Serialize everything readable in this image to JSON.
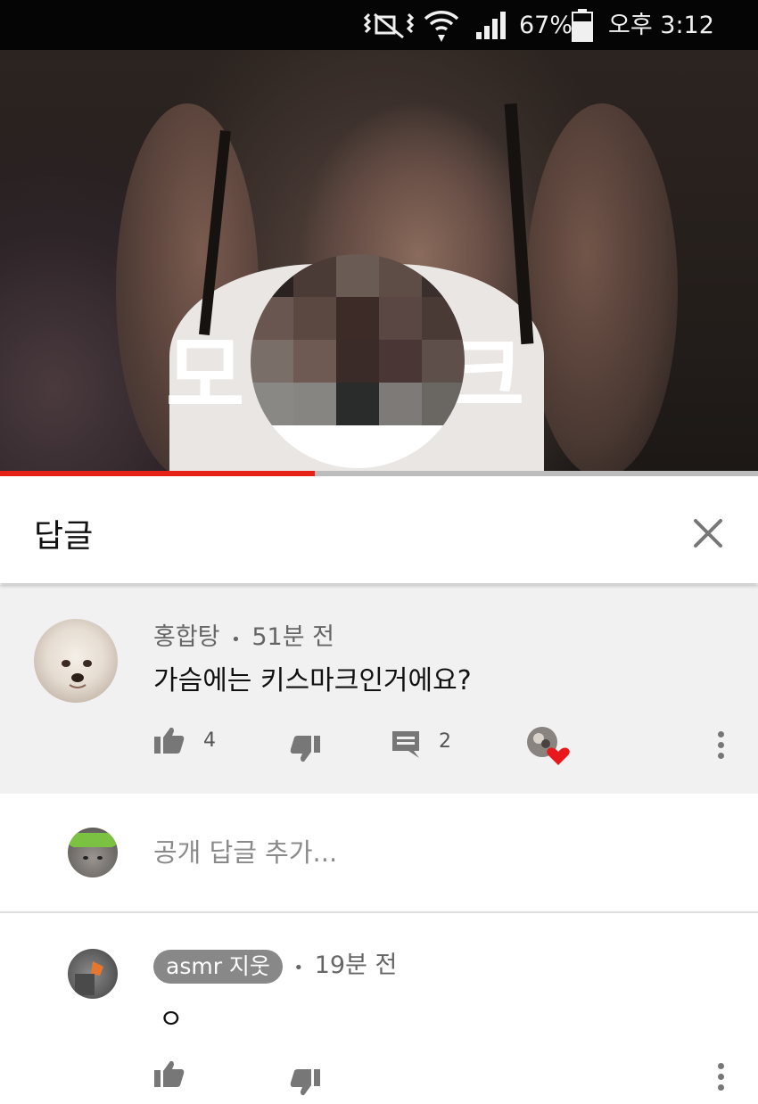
{
  "status_bar": {
    "battery": "67%",
    "time": "오후 3:12",
    "icons": [
      "mute-icon",
      "wifi-icon",
      "signal-icon",
      "battery-icon"
    ]
  },
  "video": {
    "overlay_left": "모",
    "overlay_right": "크",
    "progress": 0.415,
    "accent_color": "#e62117"
  },
  "replies_panel": {
    "title": "답글",
    "close_icon": "close-icon"
  },
  "main_comment": {
    "author": "홍합탕",
    "time": "51분 전",
    "separator": "•",
    "text": "가슴에는 키스마크인거에요?",
    "likes": "4",
    "replies": "2"
  },
  "add_reply": {
    "placeholder": "공개 답글 추가..."
  },
  "reply": {
    "author": "asmr 지웃",
    "time": "19분 전",
    "separator": "•",
    "text": "ㅇ"
  }
}
